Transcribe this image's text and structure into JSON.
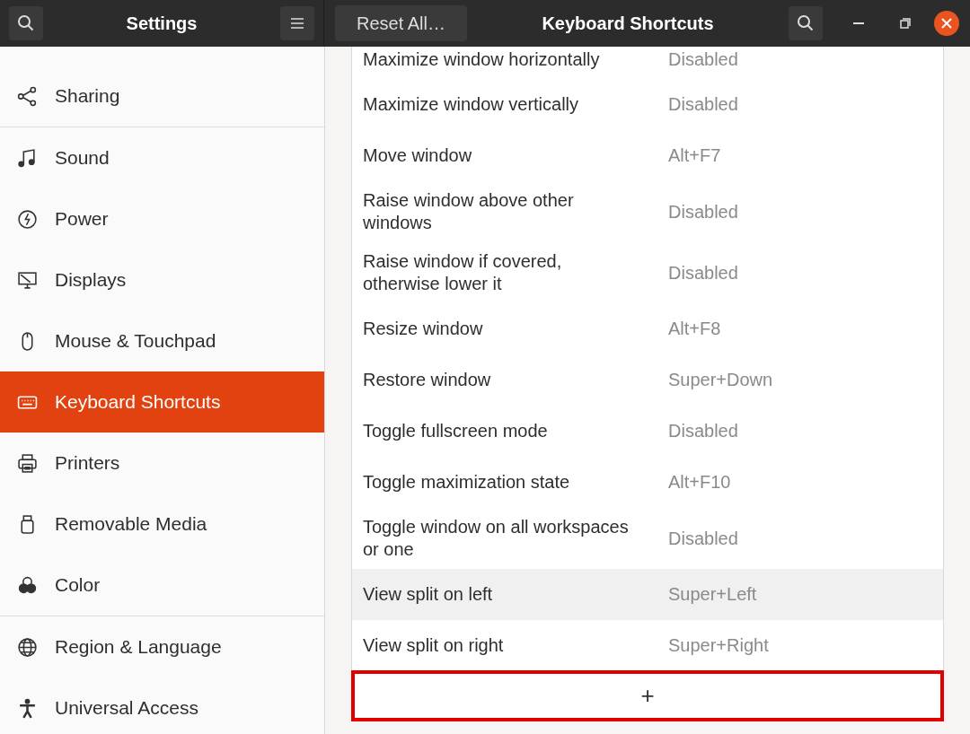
{
  "header": {
    "title": "Settings",
    "reset_button": "Reset All…",
    "panel_title": "Keyboard Shortcuts"
  },
  "sidebar": {
    "groups": [
      [
        {
          "label": "Sharing",
          "selected": false
        }
      ],
      [
        {
          "label": "Sound",
          "selected": false
        },
        {
          "label": "Power",
          "selected": false
        },
        {
          "label": "Displays",
          "selected": false
        },
        {
          "label": "Mouse & Touchpad",
          "selected": false
        },
        {
          "label": "Keyboard Shortcuts",
          "selected": true
        },
        {
          "label": "Printers",
          "selected": false
        },
        {
          "label": "Removable Media",
          "selected": false
        },
        {
          "label": "Color",
          "selected": false
        }
      ],
      [
        {
          "label": "Region & Language",
          "selected": false
        },
        {
          "label": "Universal Access",
          "selected": false
        }
      ]
    ]
  },
  "shortcuts": [
    {
      "name": "Maximize window horizontally",
      "accel": "Disabled",
      "selected": false
    },
    {
      "name": "Maximize window vertically",
      "accel": "Disabled",
      "selected": false
    },
    {
      "name": "Move window",
      "accel": "Alt+F7",
      "selected": false
    },
    {
      "name": "Raise window above other windows",
      "accel": "Disabled",
      "selected": false
    },
    {
      "name": "Raise window if covered, otherwise lower it",
      "accel": "Disabled",
      "selected": false
    },
    {
      "name": "Resize window",
      "accel": "Alt+F8",
      "selected": false
    },
    {
      "name": "Restore window",
      "accel": "Super+Down",
      "selected": false
    },
    {
      "name": "Toggle fullscreen mode",
      "accel": "Disabled",
      "selected": false
    },
    {
      "name": "Toggle maximization state",
      "accel": "Alt+F10",
      "selected": false
    },
    {
      "name": "Toggle window on all workspaces or one",
      "accel": "Disabled",
      "selected": false
    },
    {
      "name": "View split on left",
      "accel": "Super+Left",
      "selected": true
    },
    {
      "name": "View split on right",
      "accel": "Super+Right",
      "selected": false
    }
  ],
  "add_button": "+"
}
